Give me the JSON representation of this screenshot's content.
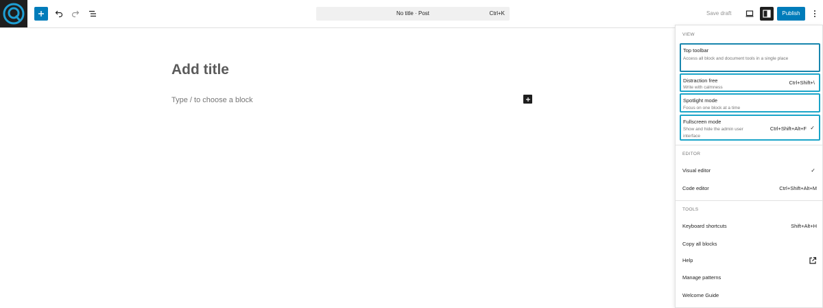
{
  "toolbar": {
    "logo_icon": "wordpress-site-icon",
    "add_block_icon": "plus-icon",
    "undo_icon": "undo-icon",
    "redo_icon": "redo-icon",
    "list_view_icon": "list-view-icon",
    "command_title": "No title · Post",
    "command_shortcut": "Ctrl+K",
    "save_draft": "Save draft",
    "view_icon": "desktop-view-icon",
    "settings_icon": "settings-sidebar-icon",
    "publish": "Publish",
    "options_icon": "more-vertical-icon",
    "accent_color": "#007cba"
  },
  "editor": {
    "title_placeholder": "Add title",
    "block_placeholder": "Type / to choose a block",
    "inserter_icon": "plus-icon"
  },
  "menu": {
    "view_label": "VIEW",
    "view_options": [
      {
        "title": "Top toolbar",
        "description": "Access all block and document tools in a single place",
        "shortcut": "",
        "checked": false
      },
      {
        "title": "Distraction free",
        "description": "Write with calmness",
        "shortcut": "Ctrl+Shift+\\",
        "checked": false
      },
      {
        "title": "Spotlight mode",
        "description": "Focus on one block at a time",
        "shortcut": "",
        "checked": false
      },
      {
        "title": "Fullscreen mode",
        "description": "Show and hide the admin user interface",
        "shortcut": "Ctrl+Shift+Alt+F",
        "checked": true
      }
    ],
    "editor_label": "EDITOR",
    "editor_items": [
      {
        "label": "Visual editor",
        "shortcut": "",
        "checked": true
      },
      {
        "label": "Code editor",
        "shortcut": "Ctrl+Shift+Alt+M",
        "checked": false
      }
    ],
    "tools_label": "TOOLS",
    "tools_items": [
      {
        "label": "Keyboard shortcuts",
        "shortcut": "Shift+Alt+H"
      },
      {
        "label": "Copy all blocks",
        "shortcut": ""
      },
      {
        "label": "Help",
        "shortcut": "",
        "icon": "external-link-icon"
      },
      {
        "label": "Manage patterns",
        "shortcut": ""
      },
      {
        "label": "Welcome Guide",
        "shortcut": ""
      }
    ],
    "check_glyph": "✓",
    "highlight_color": "#1aa4c8"
  }
}
